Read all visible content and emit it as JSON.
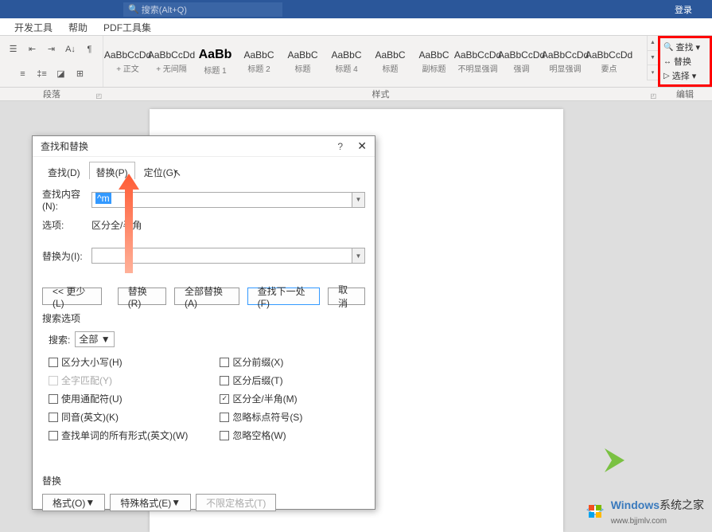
{
  "title_bar": {
    "search_placeholder": "搜索(Alt+Q)",
    "login": "登录"
  },
  "ribbon_tabs": [
    "开发工具",
    "帮助",
    "PDF工具集"
  ],
  "styles": [
    {
      "preview": "AaBbCcDd",
      "label": "+ 正文"
    },
    {
      "preview": "AaBbCcDd",
      "label": "+ 无间隔"
    },
    {
      "preview": "AaBb",
      "label": "标题 1",
      "big": true
    },
    {
      "preview": "AaBbC",
      "label": "标题 2"
    },
    {
      "preview": "AaBbC",
      "label": "标题"
    },
    {
      "preview": "AaBbC",
      "label": "标题 4"
    },
    {
      "preview": "AaBbC",
      "label": "标题"
    },
    {
      "preview": "AaBbC",
      "label": "副标题"
    },
    {
      "preview": "AaBbCcDd",
      "label": "不明显强调"
    },
    {
      "preview": "AaBbCcDd",
      "label": "强调"
    },
    {
      "preview": "AaBbCcDd",
      "label": "明显强调"
    },
    {
      "preview": "AaBbCcDd",
      "label": "要点"
    }
  ],
  "group_labels": {
    "para": "段落",
    "styles": "样式",
    "edit": "编辑"
  },
  "edit_group": {
    "find": "查找",
    "replace": "替换",
    "select": "选择"
  },
  "dialog": {
    "title": "查找和替换",
    "tabs": {
      "find": "查找(D)",
      "replace": "替换(P)",
      "goto": "定位(G)"
    },
    "find_label": "查找内容(N):",
    "find_value": "^m",
    "options_label": "选项:",
    "options_value": "区分全/半角",
    "replace_label": "替换为(I):",
    "buttons": {
      "less": "<< 更少(L)",
      "replace": "替换(R)",
      "replace_all": "全部替换(A)",
      "find_next": "查找下一处(F)",
      "cancel": "取消"
    },
    "search_options_title": "搜索选项",
    "search_label": "搜索:",
    "search_scope": "全部",
    "checkboxes_left": [
      {
        "label": "区分大小写(H)",
        "checked": false,
        "disabled": false
      },
      {
        "label": "全字匹配(Y)",
        "checked": false,
        "disabled": true
      },
      {
        "label": "使用通配符(U)",
        "checked": false,
        "disabled": false
      },
      {
        "label": "同音(英文)(K)",
        "checked": false,
        "disabled": false
      },
      {
        "label": "查找单词的所有形式(英文)(W)",
        "checked": false,
        "disabled": false
      }
    ],
    "checkboxes_right": [
      {
        "label": "区分前缀(X)",
        "checked": false,
        "disabled": false
      },
      {
        "label": "区分后缀(T)",
        "checked": false,
        "disabled": false
      },
      {
        "label": "区分全/半角(M)",
        "checked": true,
        "disabled": false
      },
      {
        "label": "忽略标点符号(S)",
        "checked": false,
        "disabled": false
      },
      {
        "label": "忽略空格(W)",
        "checked": false,
        "disabled": false
      }
    ],
    "replace_section": "替换",
    "format_btn": "格式(O)",
    "special_btn": "特殊格式(E)",
    "no_format_btn": "不限定格式(T)"
  },
  "watermark": {
    "main": "Windows",
    "sub": "系统之家",
    "url": "www.bjjmlv.com"
  },
  "colors": {
    "accent": "#2b579a",
    "highlight_border": "#ff0000"
  }
}
